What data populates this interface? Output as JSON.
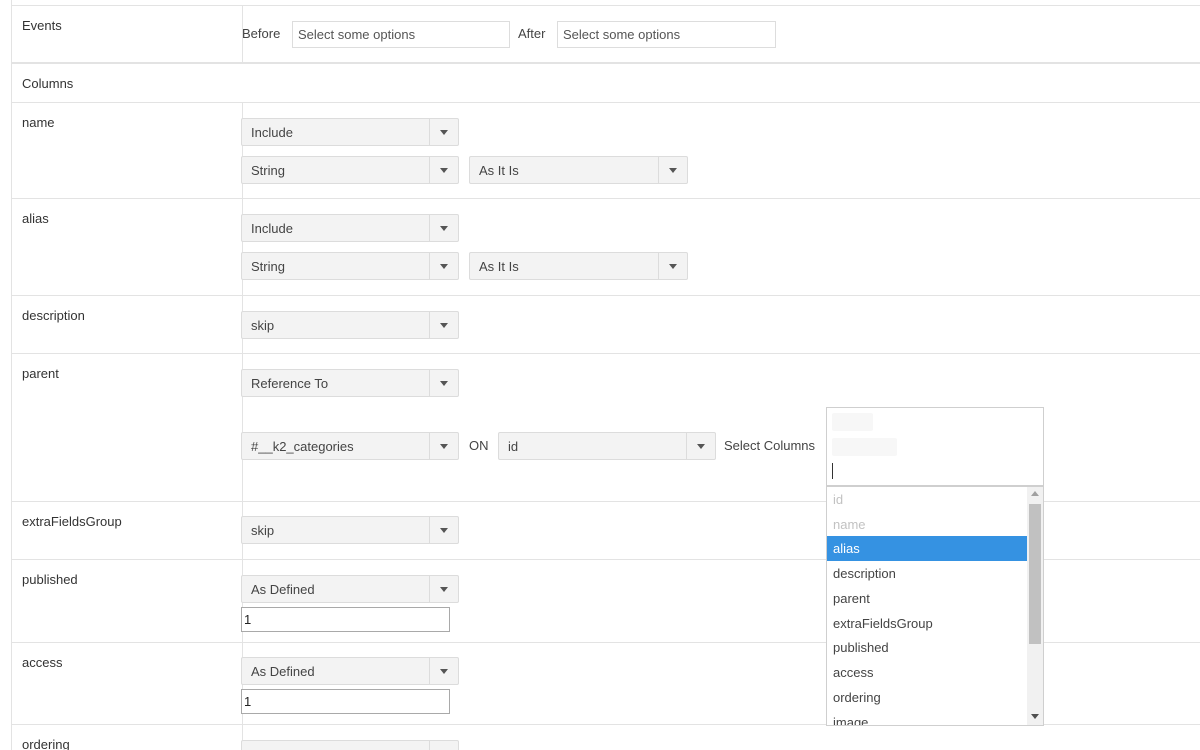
{
  "events": {
    "label": "Events",
    "before_label": "Before",
    "before_placeholder": "Select some options",
    "after_label": "After",
    "after_placeholder": "Select some options"
  },
  "columns_heading": "Columns",
  "rows": {
    "name": {
      "label": "name",
      "mode": "Include",
      "type": "String",
      "transform": "As It Is"
    },
    "alias": {
      "label": "alias",
      "mode": "Include",
      "type": "String",
      "transform": "As It Is"
    },
    "description": {
      "label": "description",
      "mode": "skip"
    },
    "parent": {
      "label": "parent",
      "mode": "Reference To",
      "table": "#__k2_categories",
      "on_label": "ON",
      "on_column": "id",
      "select_columns_label": "Select Columns"
    },
    "extraFieldsGroup": {
      "label": "extraFieldsGroup",
      "mode": "skip"
    },
    "published": {
      "label": "published",
      "mode": "As Defined",
      "value": "1"
    },
    "access": {
      "label": "access",
      "mode": "As Defined",
      "value": "1"
    },
    "ordering": {
      "label": "ordering"
    }
  },
  "dropdown": {
    "options": [
      {
        "label": "id",
        "state": "disabled"
      },
      {
        "label": "name",
        "state": "disabled"
      },
      {
        "label": "alias",
        "state": "active"
      },
      {
        "label": "description",
        "state": "normal"
      },
      {
        "label": "parent",
        "state": "normal"
      },
      {
        "label": "extraFieldsGroup",
        "state": "normal"
      },
      {
        "label": "published",
        "state": "normal"
      },
      {
        "label": "access",
        "state": "normal"
      },
      {
        "label": "ordering",
        "state": "normal"
      },
      {
        "label": "image",
        "state": "normal"
      }
    ],
    "highlight_color": "#3592e2"
  }
}
